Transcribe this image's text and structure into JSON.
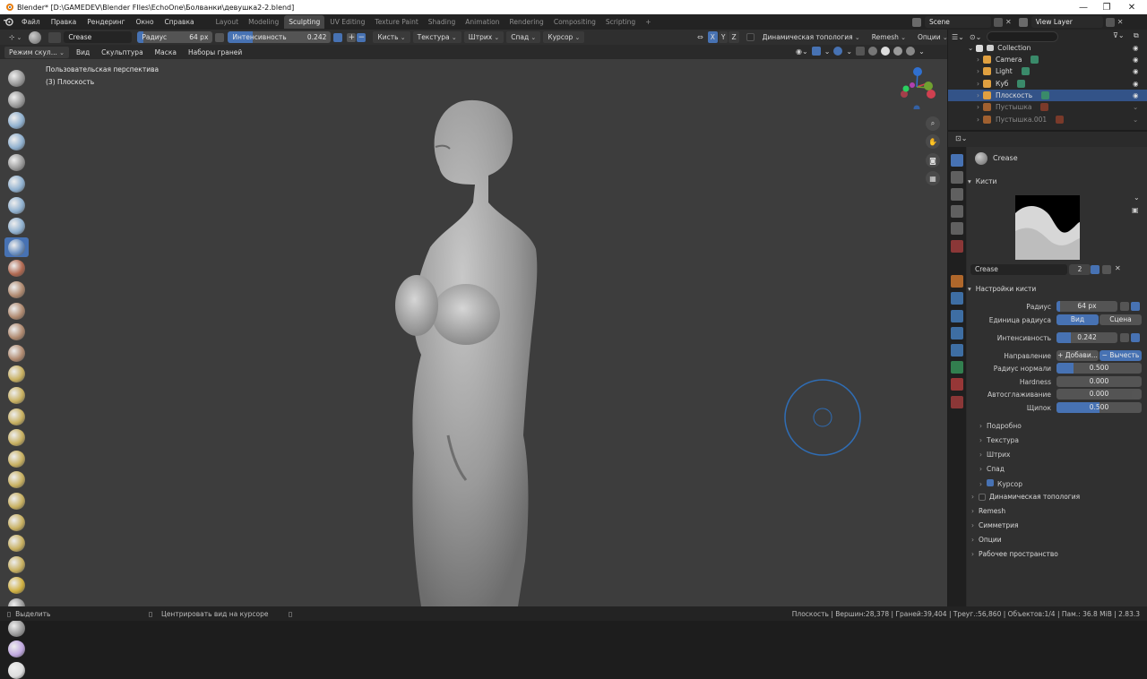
{
  "window": {
    "title": "Blender* [D:\\GAMEDEV\\Blender FIles\\EchoOne\\Болванки\\девушка2-2.blend]",
    "controls": [
      "—",
      "❐",
      "✕"
    ]
  },
  "menu": [
    "Файл",
    "Правка",
    "Рендеринг",
    "Окно",
    "Справка"
  ],
  "workspaces": [
    {
      "label": "Layout",
      "active": false
    },
    {
      "label": "Modeling",
      "active": false
    },
    {
      "label": "Sculpting",
      "active": true
    },
    {
      "label": "UV Editing",
      "active": false
    },
    {
      "label": "Texture Paint",
      "active": false
    },
    {
      "label": "Shading",
      "active": false
    },
    {
      "label": "Animation",
      "active": false
    },
    {
      "label": "Rendering",
      "active": false
    },
    {
      "label": "Compositing",
      "active": false
    },
    {
      "label": "Scripting",
      "active": false
    }
  ],
  "scene": {
    "name": "Scene",
    "view_layer": "View Layer",
    "add_tab": "+"
  },
  "tool_header": {
    "brush_name": "Crease",
    "radius_label": "Радиус",
    "radius_value": "64 px",
    "strength_label": "Интенсивность",
    "strength_value": "0.242",
    "strength_fraction": 0.242,
    "menus": [
      "Кисть",
      "Текстура",
      "Штрих",
      "Спад",
      "Курсор"
    ],
    "axes": [
      "X",
      "Y",
      "Z"
    ],
    "dyntopo": "Динамическая топология",
    "remesh": "Remesh",
    "options": "Опции"
  },
  "view_header": {
    "mode": "Режим скул...",
    "menus": [
      "Вид",
      "Скульптура",
      "Маска",
      "Наборы граней"
    ]
  },
  "viewport": {
    "perspective": "Пользовательская перспектива",
    "object": "(3) Плоскость",
    "gizmo_axes": [
      "X",
      "Y",
      "Z"
    ]
  },
  "outliner": {
    "search_placeholder": "",
    "collection": "Collection",
    "items": [
      {
        "name": "Camera",
        "icon": "camera-icon",
        "color": "#e0a040",
        "selected": false,
        "dim": false
      },
      {
        "name": "Light",
        "icon": "light-icon",
        "color": "#e0a040",
        "selected": false,
        "dim": false
      },
      {
        "name": "Куб",
        "icon": "mesh-icon",
        "color": "#e0a040",
        "selected": false,
        "dim": false
      },
      {
        "name": "Плоскость",
        "icon": "mesh-icon",
        "color": "#e0a040",
        "selected": true,
        "dim": false
      },
      {
        "name": "Пустышка",
        "icon": "empty-icon",
        "color": "#a06030",
        "selected": false,
        "dim": true
      },
      {
        "name": "Пустышка.001",
        "icon": "empty-icon",
        "color": "#a06030",
        "selected": false,
        "dim": true
      }
    ]
  },
  "properties": {
    "tool_name": "Crease",
    "brushes_header": "Кисти",
    "brush_field": "Crease",
    "brush_users": "2",
    "settings_header": "Настройки кисти",
    "rows": [
      {
        "label": "Радиус",
        "value": "64 px",
        "fill": 0.06
      },
      {
        "label": "Единица радиуса",
        "options": [
          "Вид",
          "Сцена"
        ],
        "selected": 0
      },
      {
        "label": "Интенсивность",
        "value": "0.242",
        "fill": 0.242
      },
      {
        "label": "Направление",
        "options": [
          "+ Добави...",
          "− Вычесть"
        ],
        "selected": 1
      },
      {
        "label": "Радиус нормали",
        "value": "0.500",
        "fill": 0.2
      },
      {
        "label": "Hardness",
        "value": "0.000",
        "fill": 0
      },
      {
        "label": "Автосглаживание",
        "value": "0.000",
        "fill": 0
      },
      {
        "label": "Щипок",
        "value": "0.500",
        "fill": 0.5
      }
    ],
    "subpanels": [
      "Подробно",
      "Текстура",
      "Штрих",
      "Спад",
      "Курсор"
    ],
    "sections": [
      "Динамическая топология",
      "Remesh",
      "Симметрия",
      "Опции",
      "Рабочее пространство"
    ]
  },
  "status": {
    "left": "Выделить",
    "middle": "Центрировать вид на курсоре",
    "stats": "Плоскость | Вершин:28,378 | Граней:39,404 | Треуг.:56,860 | Объектов:1/4 | Пам.: 36.8 MiB | 2.83.3"
  },
  "colors": {
    "accent": "#4772b3",
    "selected_row": "#335388",
    "viewport": "#3d3d3d",
    "cursor_circle": "#2f6db5"
  }
}
